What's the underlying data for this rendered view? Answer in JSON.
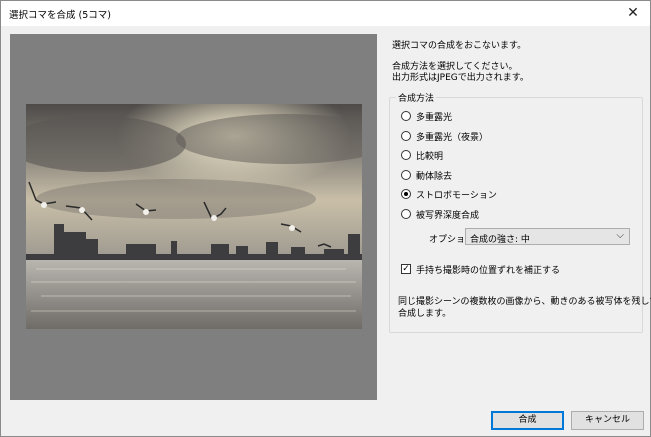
{
  "window": {
    "title": "選択コマを合成 (5コマ)",
    "close_symbol": "✕"
  },
  "intro": {
    "line1": "選択コマの合成をおこないます。",
    "line2": "合成方法を選択してください。",
    "line3": "出力形式はJPEGで出力されます。"
  },
  "method_group": {
    "label": "合成方法",
    "options": [
      {
        "label": "多重露光",
        "selected": false
      },
      {
        "label": "多重露光（夜景）",
        "selected": false
      },
      {
        "label": "比較明",
        "selected": false
      },
      {
        "label": "動体除去",
        "selected": false
      },
      {
        "label": "ストロボモーション",
        "selected": true
      },
      {
        "label": "被写界深度合成",
        "selected": false
      }
    ],
    "option_label": "オプション",
    "option_value": "合成の強さ: 中",
    "chevron": "⌵",
    "align_checkbox": {
      "label": "手持ち撮影時の位置ずれを補正する",
      "checked": true,
      "mark": "✓"
    },
    "description_line1": "同じ撮影シーンの複数枚の画像から、動きのある被写体を残して",
    "description_line2": "合成します。"
  },
  "buttons": {
    "ok": "合成",
    "cancel": "キャンセル"
  },
  "colors": {
    "preview_bg": "#7f7f7f",
    "default_button_border": "#0078d7"
  }
}
